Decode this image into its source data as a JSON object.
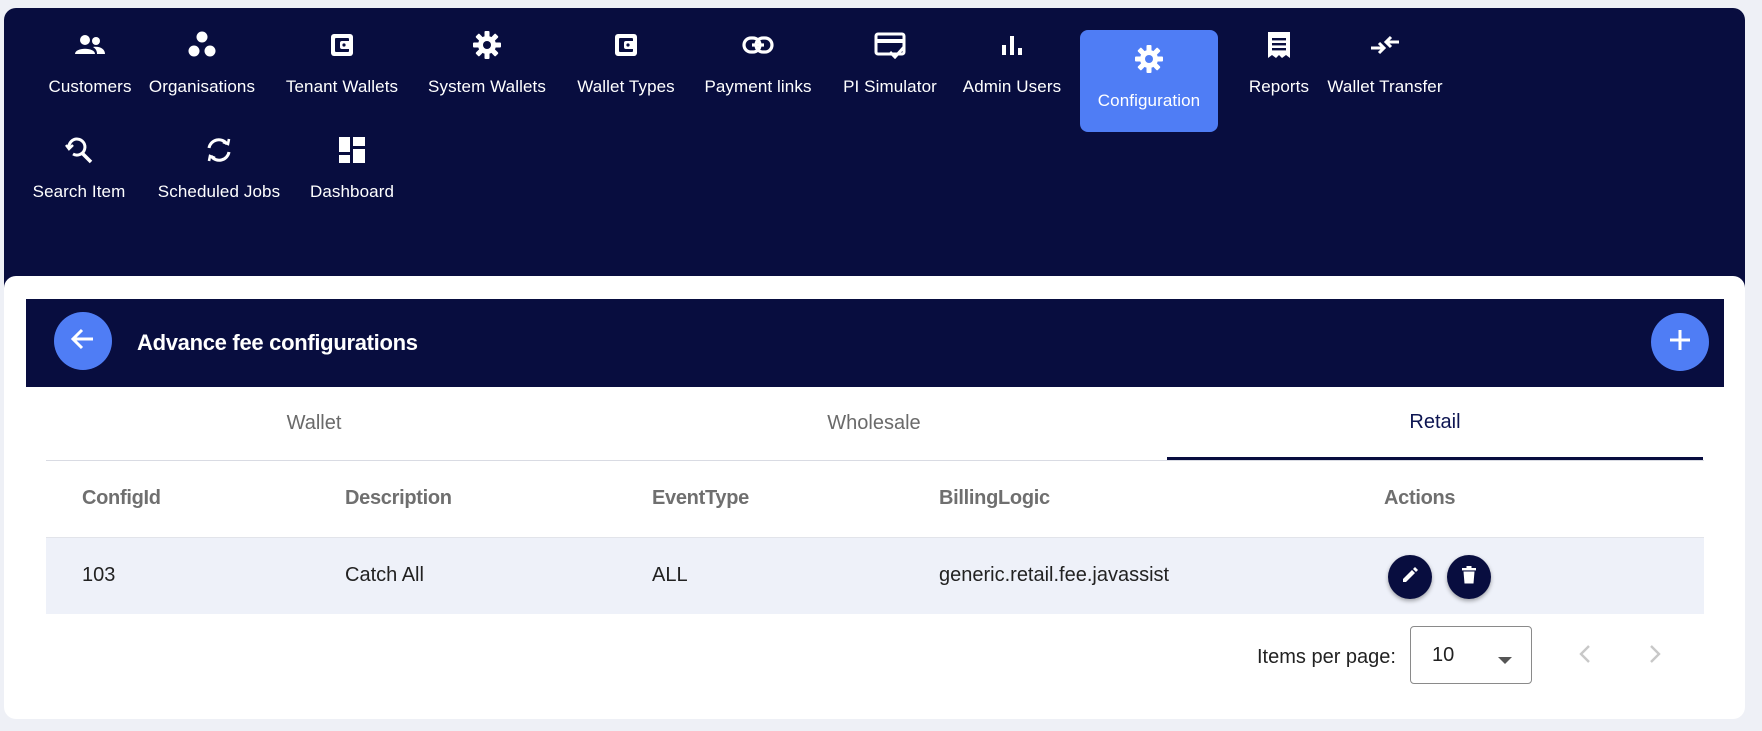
{
  "nav": {
    "items": [
      {
        "label": "Customers",
        "icon": "customers-icon"
      },
      {
        "label": "Organisations",
        "icon": "organisations-icon"
      },
      {
        "label": "Tenant Wallets",
        "icon": "wallet-icon"
      },
      {
        "label": "System Wallets",
        "icon": "gear-icon"
      },
      {
        "label": "Wallet Types",
        "icon": "wallet-icon"
      },
      {
        "label": "Payment links",
        "icon": "link-icon"
      },
      {
        "label": "PI Simulator",
        "icon": "card-check-icon"
      },
      {
        "label": "Admin Users",
        "icon": "bar-chart-icon"
      },
      {
        "label": "Configuration",
        "icon": "gear-icon",
        "active": true
      },
      {
        "label": "Reports",
        "icon": "receipt-icon"
      },
      {
        "label": "Wallet Transfer",
        "icon": "transfer-icon"
      },
      {
        "label": "Search Item",
        "icon": "search-icon"
      },
      {
        "label": "Scheduled Jobs",
        "icon": "sync-icon"
      },
      {
        "label": "Dashboard",
        "icon": "dashboard-icon"
      }
    ]
  },
  "header": {
    "title": "Advance fee configurations"
  },
  "tabs": [
    {
      "label": "Wallet",
      "active": false
    },
    {
      "label": "Wholesale",
      "active": false
    },
    {
      "label": "Retail",
      "active": true
    }
  ],
  "table": {
    "columns": [
      "ConfigId",
      "Description",
      "EventType",
      "BillingLogic",
      "Actions"
    ],
    "rows": [
      {
        "config_id": "103",
        "description": "Catch All",
        "event_type": "ALL",
        "billing_logic": "generic.retail.fee.javassist"
      }
    ]
  },
  "paginator": {
    "items_per_page_label": "Items per page:",
    "page_size": "10"
  },
  "colors": {
    "navy": "#080d3f",
    "accent": "#4f7df5",
    "row_bg": "#eef1f9"
  }
}
